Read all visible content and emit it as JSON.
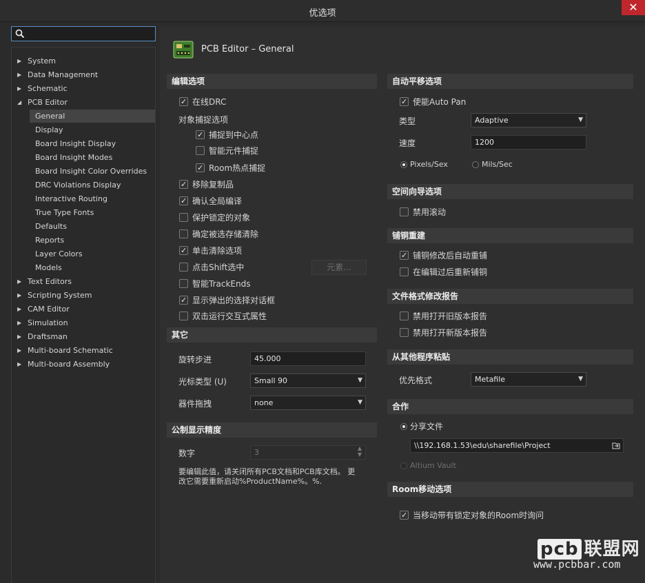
{
  "window": {
    "title": "优选项",
    "close_label": "✕"
  },
  "search": {
    "placeholder": ""
  },
  "tree": {
    "items": [
      {
        "label": "System",
        "arrow": "▶"
      },
      {
        "label": "Data Management",
        "arrow": "▶"
      },
      {
        "label": "Schematic",
        "arrow": "▶"
      },
      {
        "label": "PCB Editor",
        "arrow": "◢"
      },
      {
        "label": "General"
      },
      {
        "label": "Display"
      },
      {
        "label": "Board Insight Display"
      },
      {
        "label": "Board Insight Modes"
      },
      {
        "label": "Board Insight Color Overrides"
      },
      {
        "label": "DRC Violations Display"
      },
      {
        "label": "Interactive Routing"
      },
      {
        "label": "True Type Fonts"
      },
      {
        "label": "Defaults"
      },
      {
        "label": "Reports"
      },
      {
        "label": "Layer Colors"
      },
      {
        "label": "Models"
      },
      {
        "label": "Text Editors",
        "arrow": "▶"
      },
      {
        "label": "Scripting System",
        "arrow": "▶"
      },
      {
        "label": "CAM Editor",
        "arrow": "▶"
      },
      {
        "label": "Simulation",
        "arrow": "▶"
      },
      {
        "label": "Draftsman",
        "arrow": "▶"
      },
      {
        "label": "Multi-board Schematic",
        "arrow": "▶"
      },
      {
        "label": "Multi-board Assembly",
        "arrow": "▶"
      }
    ]
  },
  "page": {
    "title": "PCB Editor – General"
  },
  "edit": {
    "header": "编辑选项",
    "online_drc": "在线DRC",
    "snap_group": "对象捕捉选项",
    "snap_center": "捕捉到中心点",
    "smart_snap": "智能元件捕捉",
    "room_hotspot": "Room热点捕捉",
    "remove_dup": "移除复制品",
    "confirm_global": "确认全局编译",
    "protect_locked": "保护锁定的对象",
    "confirm_clear": "确定被选存储清除",
    "click_clear": "单击清除选项",
    "shift_click": "点击Shift选中",
    "primitives_btn": "元素...",
    "smart_trackends": "智能TrackEnds",
    "show_popup": "显示弹出的选择对话框",
    "dblclick_inspector": "双击运行交互式属性"
  },
  "other": {
    "header": "其它",
    "rotation_label": "旋转步进",
    "rotation_value": "45.000",
    "cursor_label": "光标类型 (U)",
    "cursor_value": "Small 90",
    "drag_label": "器件拖拽",
    "drag_value": "none"
  },
  "metric": {
    "header": "公制显示精度",
    "digits_label": "数字",
    "digits_value": "3",
    "note_line1": "要编辑此值，请关闭所有PCB文档和PCB库文档。 更",
    "note_line2": "改它需要重新启动%ProductName%。%."
  },
  "autopan": {
    "header": "自动平移选项",
    "enable": "使能Auto Pan",
    "type_label": "类型",
    "type_value": "Adaptive",
    "speed_label": "速度",
    "speed_value": "1200",
    "unit_pixels": "Pixels/Sex",
    "unit_mils": "Mils/Sec"
  },
  "spacenav": {
    "header": "空间向导选项",
    "disable_roll": "禁用滚动"
  },
  "polygon": {
    "header": "铺铜重建",
    "auto_repour": "铺铜修改后自动重铺",
    "repour_after_edit": "在编辑过后重新铺铜"
  },
  "fileformat": {
    "header": "文件格式修改报告",
    "disable_old": "禁用打开旧版本报告",
    "disable_new": "禁用打开新版本报告"
  },
  "paste": {
    "header": "从其他程序粘贴",
    "pref_label": "优先格式",
    "pref_value": "Metafile"
  },
  "collab": {
    "header": "合作",
    "share_file": "分享文件",
    "share_path": "\\\\192.168.1.53\\edu\\sharefile\\Project",
    "altium_vault": "Altium Vault"
  },
  "room": {
    "header": "Room移动选项",
    "ask_locked": "当移动带有锁定对象的Room时询问"
  },
  "watermark": {
    "brand": "pcb",
    "brand_cn": "联盟网",
    "url": "www.pcbbar.com"
  }
}
